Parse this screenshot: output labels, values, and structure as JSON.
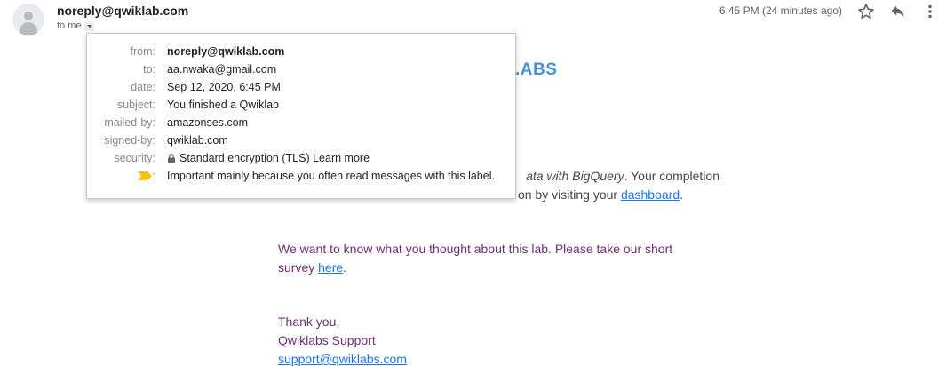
{
  "header": {
    "sender": "noreply@qwiklab.com",
    "to_label": "to me",
    "time": "6:45 PM (24 minutes ago)",
    "icons": {
      "star": "star-icon",
      "reply": "reply-icon",
      "more": "more-vert-icon"
    }
  },
  "details": {
    "from_label": "from:",
    "from": "noreply@qwiklab.com",
    "to_label": "to:",
    "to": "aa.nwaka@gmail.com",
    "date_label": "date:",
    "date": "Sep 12, 2020, 6:45 PM",
    "subject_label": "subject:",
    "subject": "You finished a Qwiklab",
    "mailedby_label": "mailed-by:",
    "mailedby": "amazonses.com",
    "signedby_label": "signed-by:",
    "signedby": "qwiklab.com",
    "security_label": "security:",
    "security": "Standard encryption (TLS)",
    "learn_more": "Learn more",
    "importance_label": ":",
    "importance": "Important mainly because you often read messages with this label."
  },
  "email": {
    "brand_fragment": ".ABS",
    "line1_italic": "ata with BigQuery",
    "line1_rest": ". Your completion",
    "line2_pre": "on by visiting your ",
    "dashboard": "dashboard",
    "line2_post": ".",
    "survey_line1": "We want to know what you thought about this lab. Please take our short",
    "survey_pre": "survey ",
    "survey_link": "here",
    "survey_post": ".",
    "thanks": "Thank you,",
    "signature": "Qwiklabs Support",
    "support_email": "support@qwiklabs.com"
  },
  "colors": {
    "link": "#1a73e8",
    "purple_text": "#6b2f72",
    "brand_blue": "#4a90e2",
    "important_marker": "#f4c20d"
  }
}
